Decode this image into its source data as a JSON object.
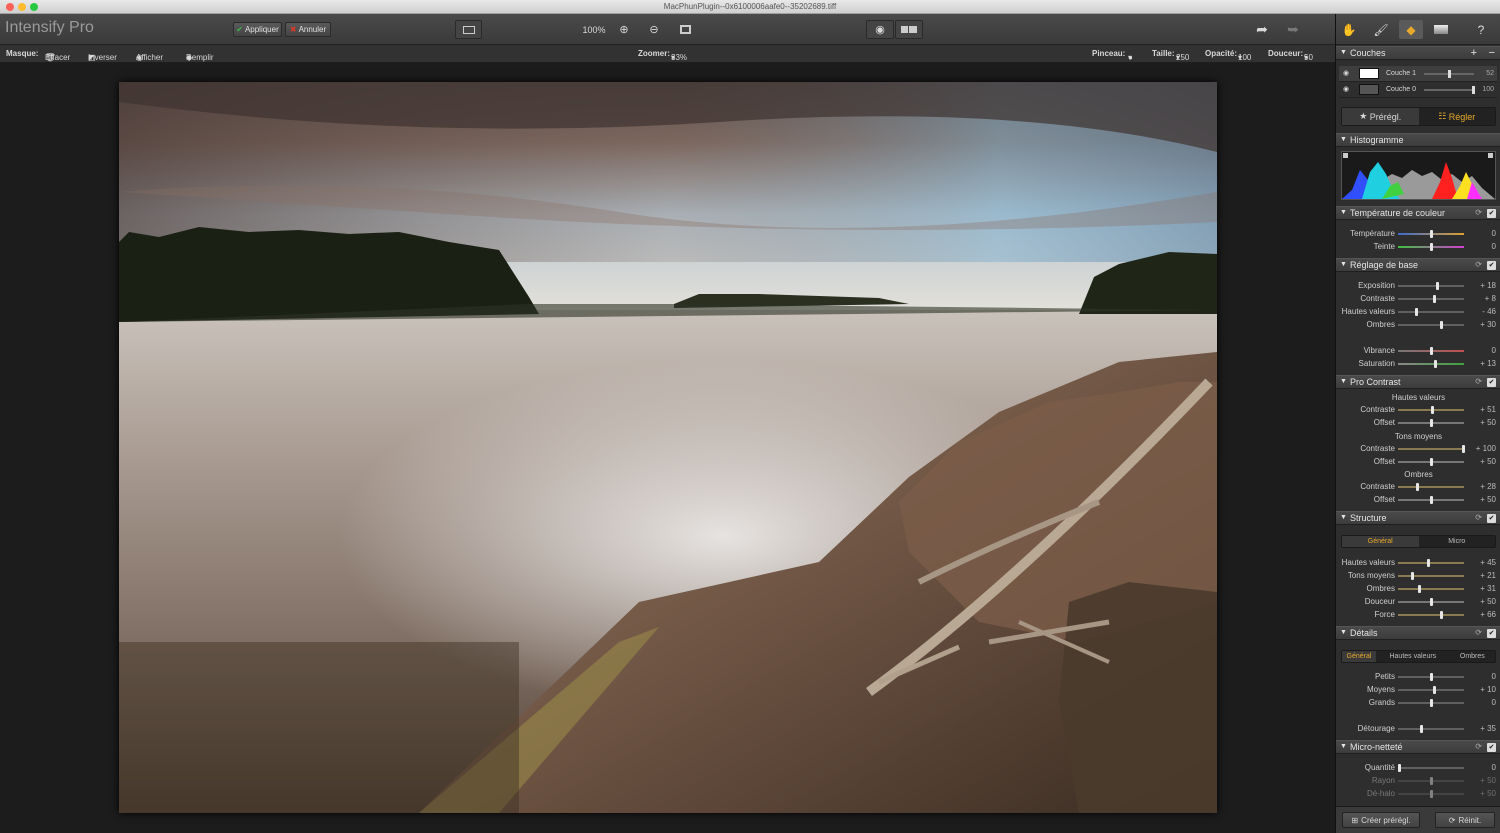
{
  "window": {
    "title": "MacPhunPlugin--0x6100006aafe0--35202689.tiff"
  },
  "app": {
    "name": "Intensify Pro"
  },
  "toolbar": {
    "apply": "Appliquer",
    "cancel": "Annuler",
    "zoom_level": "100%"
  },
  "options": {
    "mask_label": "Masque:",
    "erase": "Effacer",
    "invert": "Inverser",
    "show": "Afficher",
    "fill": "Remplir",
    "zoom_label": "Zoomer:",
    "zoom_value": "33%",
    "brush_label": "Pinceau:",
    "size_label": "Taille:",
    "size_value": "250",
    "opacity_label": "Opacité:",
    "opacity_value": "100",
    "softness_label": "Douceur:",
    "softness_value": "50"
  },
  "layers": {
    "title": "Couches",
    "items": [
      {
        "name": "Couche 1",
        "value": "52"
      },
      {
        "name": "Couche 0",
        "value": "100"
      }
    ]
  },
  "mode_tabs": {
    "presets": "Prérégl.",
    "adjust": "Régler"
  },
  "histogram": {
    "title": "Histogramme"
  },
  "temperature": {
    "title": "Température de couleur",
    "rows": [
      {
        "label": "Température",
        "value": "0",
        "pos": 0.5
      },
      {
        "label": "Teinte",
        "value": "0",
        "pos": 0.5
      }
    ]
  },
  "basic": {
    "title": "Réglage de base",
    "rows": [
      {
        "label": "Exposition",
        "value": "+ 18",
        "pos": 0.59
      },
      {
        "label": "Contraste",
        "value": "+ 8",
        "pos": 0.54
      },
      {
        "label": "Hautes valeurs",
        "value": "- 46",
        "pos": 0.27
      },
      {
        "label": "Ombres",
        "value": "+ 30",
        "pos": 0.65
      }
    ],
    "rows2": [
      {
        "label": "Vibrance",
        "value": "0",
        "pos": 0.5
      },
      {
        "label": "Saturation",
        "value": "+ 13",
        "pos": 0.57
      }
    ]
  },
  "pro_contrast": {
    "title": "Pro Contrast",
    "highlights": "Hautes valeurs",
    "midtones": "Tons moyens",
    "shadows": "Ombres",
    "rows": [
      {
        "label": "Contraste",
        "value": "+ 51",
        "pos": 0.51
      },
      {
        "label": "Offset",
        "value": "+ 50",
        "pos": 0.5
      },
      {
        "label": "Contraste",
        "value": "+ 100",
        "pos": 1.0
      },
      {
        "label": "Offset",
        "value": "+ 50",
        "pos": 0.5
      },
      {
        "label": "Contraste",
        "value": "+ 28",
        "pos": 0.28
      },
      {
        "label": "Offset",
        "value": "+ 50",
        "pos": 0.5
      }
    ]
  },
  "structure": {
    "title": "Structure",
    "tabs": [
      "Général",
      "Micro"
    ],
    "rows": [
      {
        "label": "Hautes valeurs",
        "value": "+ 45",
        "pos": 0.45
      },
      {
        "label": "Tons moyens",
        "value": "+ 21",
        "pos": 0.21
      },
      {
        "label": "Ombres",
        "value": "+ 31",
        "pos": 0.31
      },
      {
        "label": "Douceur",
        "value": "+ 50",
        "pos": 0.5
      },
      {
        "label": "Force",
        "value": "+ 66",
        "pos": 0.66
      }
    ]
  },
  "details": {
    "title": "Détails",
    "tabs": [
      "Général",
      "Hautes valeurs",
      "Ombres"
    ],
    "rows": [
      {
        "label": "Petits",
        "value": "0",
        "pos": 0.5
      },
      {
        "label": "Moyens",
        "value": "+ 10",
        "pos": 0.55
      },
      {
        "label": "Grands",
        "value": "0",
        "pos": 0.5
      }
    ],
    "cutout": {
      "label": "Détourage",
      "value": "+ 35",
      "pos": 0.35
    }
  },
  "micro_sharp": {
    "title": "Micro-netteté",
    "rows": [
      {
        "label": "Quantité",
        "value": "0",
        "pos": 0.0
      },
      {
        "label": "Rayon",
        "value": "+ 50",
        "pos": 0.5
      },
      {
        "label": "Dé-halo",
        "value": "+ 50",
        "pos": 0.5
      }
    ]
  },
  "footer": {
    "create_preset": "Créer prérégl.",
    "reset": "Réinit."
  },
  "colors": {
    "accent": "#e7a92c",
    "apply_green": "#3cb44b",
    "cancel_red": "#d23a2a"
  }
}
